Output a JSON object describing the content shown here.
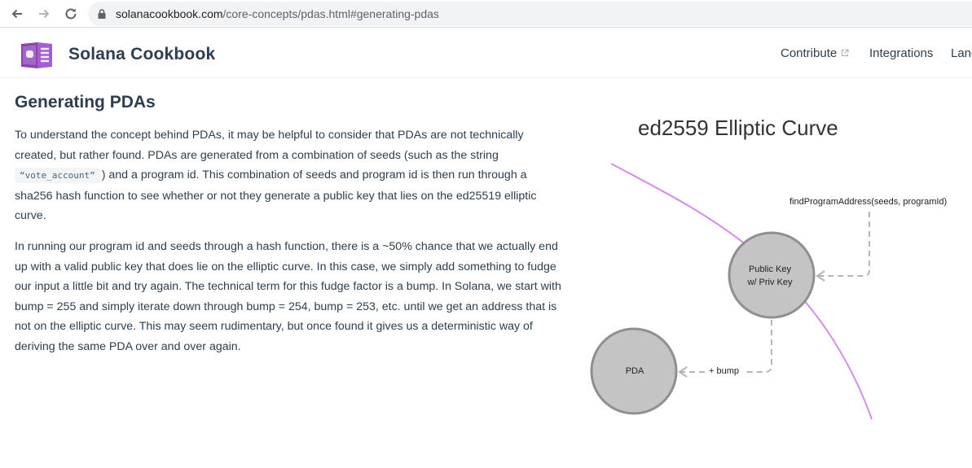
{
  "browser": {
    "url_host": "solanacookbook.com",
    "url_path": "/core-concepts/pdas.html#generating-pdas"
  },
  "header": {
    "site_title": "Solana Cookbook",
    "nav": [
      {
        "label": "Contribute",
        "external": true
      },
      {
        "label": "Integrations"
      },
      {
        "label": "Lang"
      }
    ]
  },
  "article": {
    "heading": "Generating PDAs",
    "p1_before_code": "To understand the concept behind PDAs, it may be helpful to consider that PDAs are not technically created, but rather found. PDAs are generated from a combination of seeds (such as the string",
    "p1_code": "“vote_account”",
    "p1_after_code": ") and a program id. This combination of seeds and program id is then run through a sha256 hash function to see whether or not they generate a public key that lies on the ed25519 elliptic curve.",
    "p2": "In running our program id and seeds through a hash function, there is a ~50% chance that we actually end up with a valid public key that does lie on the elliptic curve. In this case, we simply add something to fudge our input a little bit and try again. The technical term for this fudge factor is a bump. In Solana, we start with bump = 255 and simply iterate down through bump = 254, bump = 253, etc. until we get an address that is not on the elliptic curve. This may seem rudimentary, but once found it gives us a deterministic way of deriving the same PDA over and over again."
  },
  "diagram": {
    "title": "ed2559 Elliptic Curve",
    "function_label": "findProgramAddress(seeds, programId)",
    "public_key_line1": "Public Key",
    "public_key_line2": "w/ Priv Key",
    "pda_label": "PDA",
    "bump_label": "+ bump",
    "curve_color": "#d48ee6",
    "node_fill": "#c4c4c4",
    "node_stroke": "#8f8f8f",
    "arrow_color": "#b5b5b5"
  }
}
